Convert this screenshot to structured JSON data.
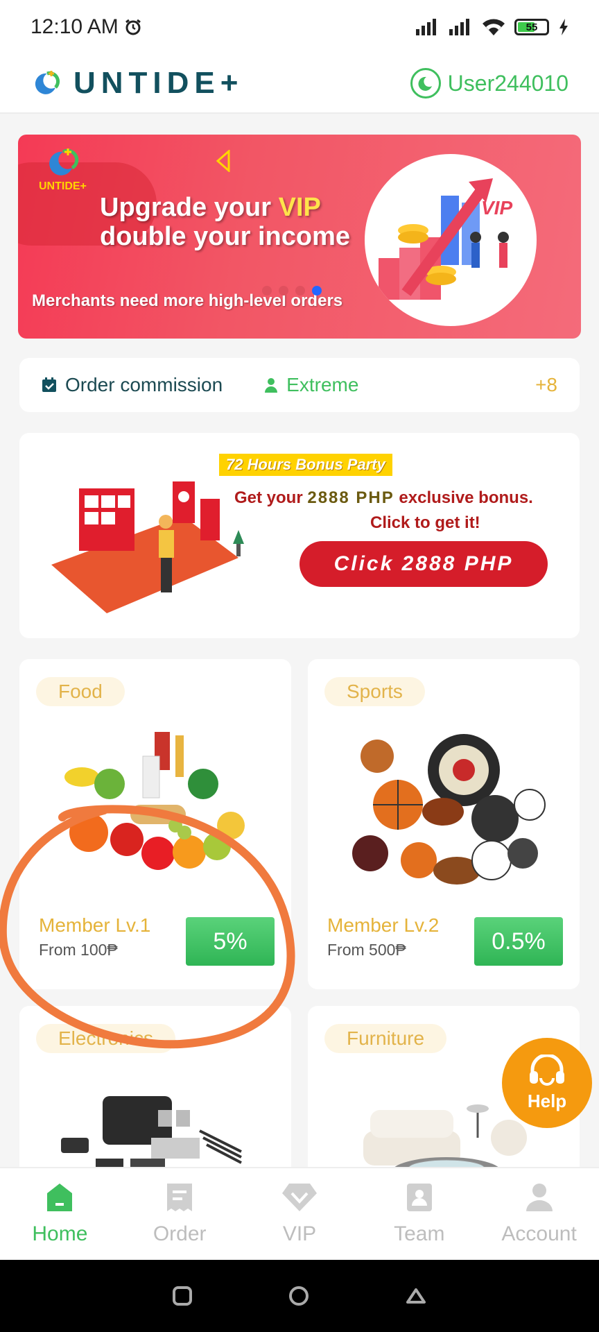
{
  "status_bar": {
    "time": "12:10 AM",
    "battery": "55"
  },
  "header": {
    "brand": "UNTIDE+",
    "username": "User244010"
  },
  "banner": {
    "brand": "UNTIDE+",
    "title_part1": "Upgrade your ",
    "title_vip": "VIP",
    "title_line2": "double your income",
    "subtitle": "Merchants need more high-level orders",
    "art_label": "VIP"
  },
  "commission": {
    "label": "Order commission",
    "level": "Extreme",
    "count": "+8"
  },
  "promo": {
    "tag": "72 Hours Bonus Party",
    "line1_pre": "Get your ",
    "line1_amount": "2888 PHP",
    "line1_post": " exclusive bonus.",
    "line2": "Click to get it!",
    "button": "Click 2888 PHP"
  },
  "cards": [
    {
      "tag": "Food",
      "level": "Member Lv.1",
      "from": "From 100₱",
      "rate": "5%"
    },
    {
      "tag": "Sports",
      "level": "Member Lv.2",
      "from": "From 500₱",
      "rate": "0.5%"
    },
    {
      "tag": "Electronics"
    },
    {
      "tag": "Furniture"
    }
  ],
  "help": {
    "label": "Help"
  },
  "nav": [
    {
      "label": "Home",
      "active": true
    },
    {
      "label": "Order"
    },
    {
      "label": "VIP"
    },
    {
      "label": "Team"
    },
    {
      "label": "Account"
    }
  ],
  "colors": {
    "accent": "#3fbf5e",
    "brand": "#12505e",
    "gold": "#e5b33a",
    "banner": "#f43a55",
    "promo_red": "#d51d2a",
    "help": "#f59a0f",
    "annotation": "#f07a3e"
  }
}
